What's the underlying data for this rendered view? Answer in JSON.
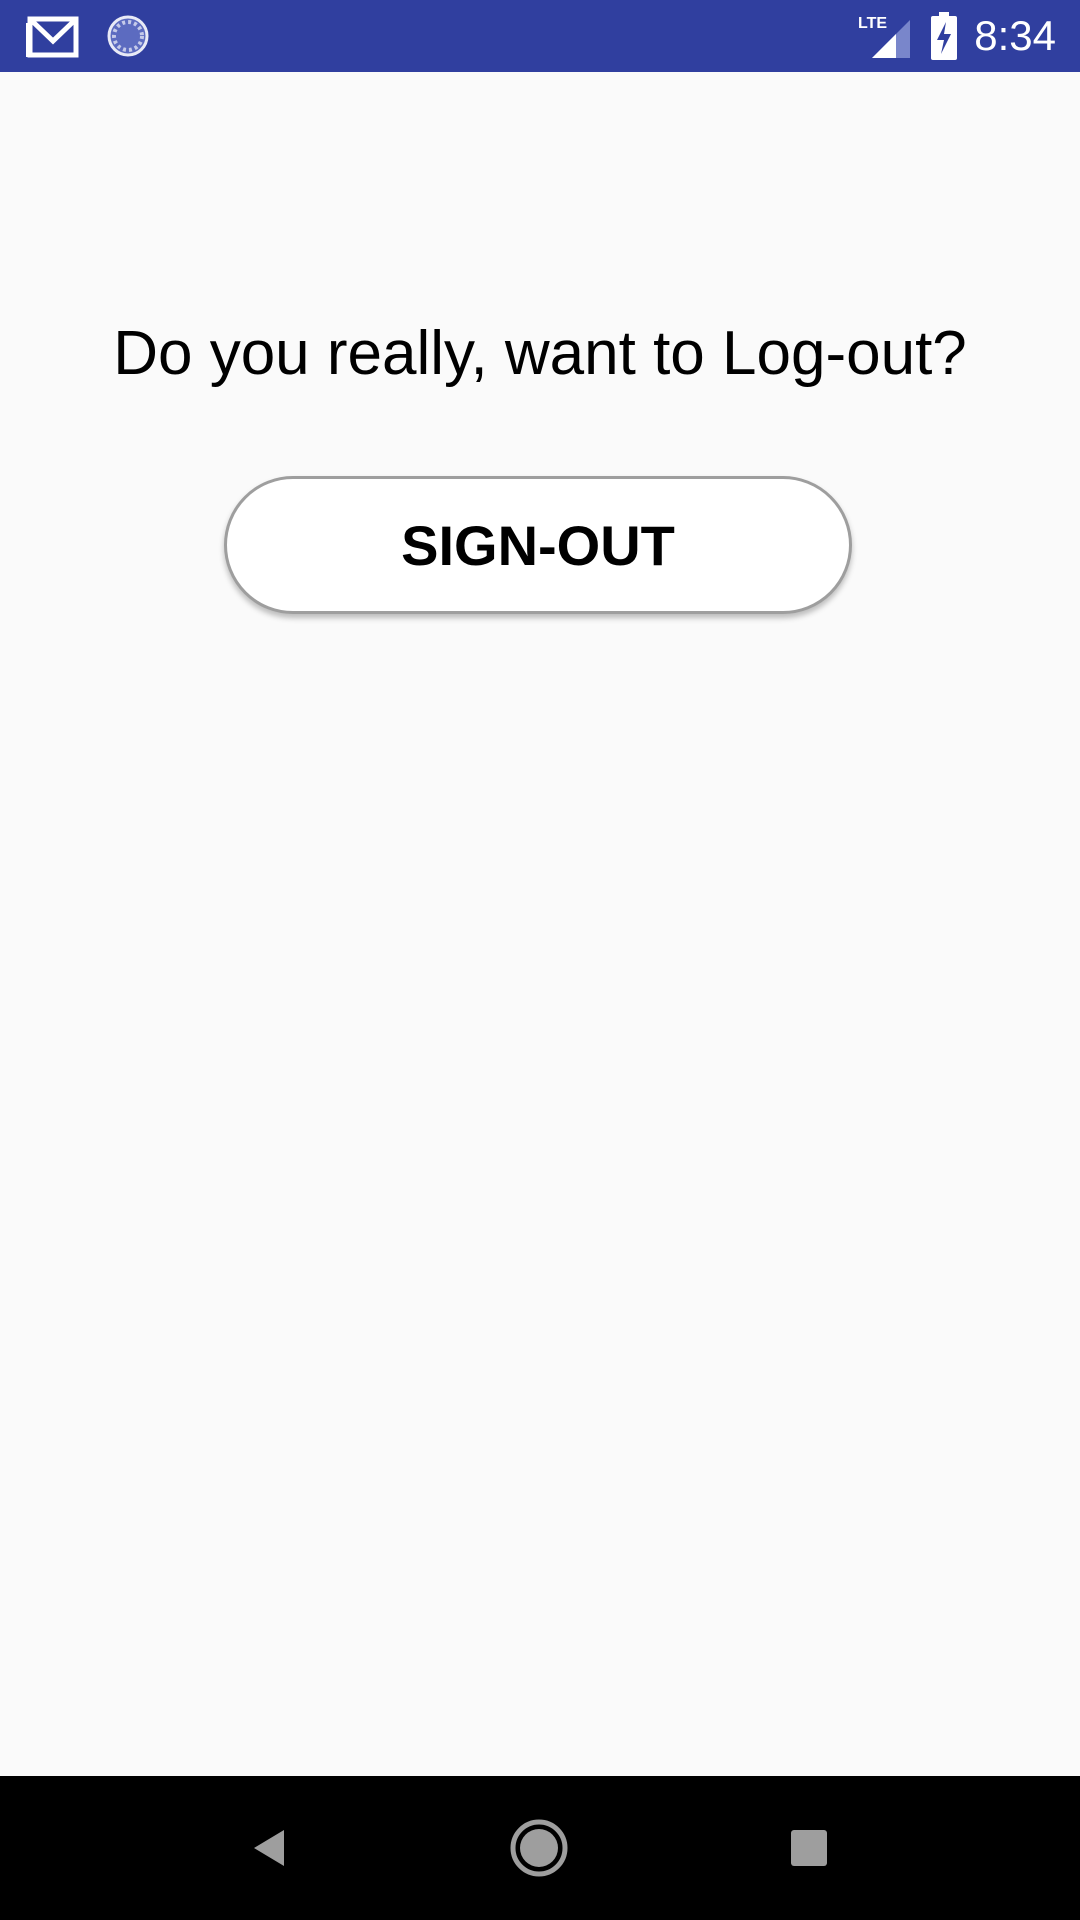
{
  "status_bar": {
    "time": "8:34",
    "network": "LTE",
    "icons": [
      "gmail-icon",
      "sync-icon",
      "lte-signal-icon",
      "battery-charging-icon"
    ],
    "background_color": "#303f9f"
  },
  "main": {
    "question": "Do you really, want to Log-out?",
    "signout_label": "SIGN-OUT"
  },
  "nav_bar": {
    "icons": [
      "back-icon",
      "home-icon",
      "recents-icon"
    ]
  }
}
